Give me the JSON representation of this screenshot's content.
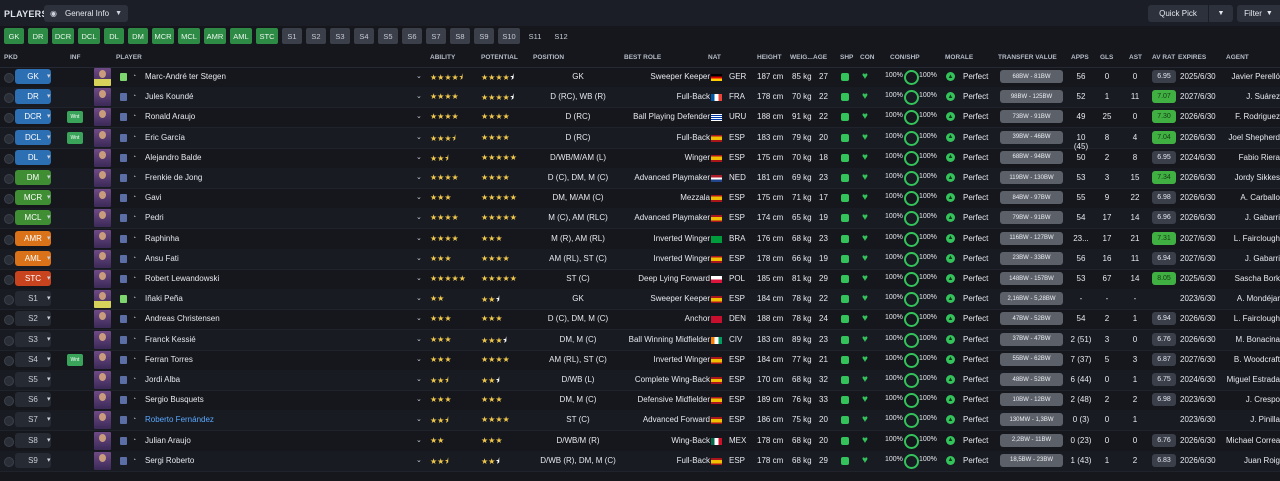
{
  "topbar": {
    "title": "PLAYERS",
    "view_label": "General Info",
    "quick_pick": "Quick Pick",
    "filter": "Filter"
  },
  "position_buttons": [
    "GK",
    "DR",
    "DCR",
    "DCL",
    "DL",
    "DM",
    "MCR",
    "MCL",
    "AMR",
    "AML",
    "STC",
    "S1",
    "S2",
    "S3",
    "S4",
    "S5",
    "S6",
    "S7",
    "S8",
    "S9",
    "S10",
    "S11",
    "S12"
  ],
  "columns": {
    "pkd": "PKD",
    "inf": "INF",
    "player": "PLAYER",
    "ability": "ABILITY",
    "potential": "POTENTIAL",
    "position": "POSITION",
    "best_role": "BEST ROLE",
    "nat": "NAT",
    "height": "HEIGHT",
    "weight": "WEIG...",
    "age": "AGE",
    "shp": "SHP",
    "con": "CON",
    "con_shp": "CON/SHP",
    "morale": "MORALE",
    "transfer_value": "TRANSFER VALUE",
    "apps": "APPS",
    "gls": "GLS",
    "ast": "AST",
    "av_rat": "AV RAT",
    "expires": "EXPIRES",
    "agent": "AGENT"
  },
  "players": [
    {
      "pos": "GK",
      "poscls": "gk",
      "inf": "",
      "name": "Marc-André ter Stegen",
      "ability": 4.5,
      "potential": 4.5,
      "position": "GK",
      "role": "Sweeper Keeper",
      "nat": "GER",
      "flag": "ger",
      "height": "187 cm",
      "weight": "85 kg",
      "age": "27",
      "con": "100%",
      "shp": "100%",
      "morale": "Perfect",
      "value": "68BW - 81BW",
      "apps": "56",
      "gls": "0",
      "ast": "0",
      "avr": "6.95",
      "avr_good": false,
      "expires": "2025/6/30",
      "agent": "Javier Perelló",
      "gk": true
    },
    {
      "pos": "DR",
      "poscls": "d",
      "inf": "",
      "name": "Jules Koundé",
      "ability": 4,
      "potential": 4.5,
      "position": "D (RC), WB (R)",
      "role": "Full-Back",
      "nat": "FRA",
      "flag": "fra",
      "height": "178 cm",
      "weight": "70 kg",
      "age": "22",
      "con": "100%",
      "shp": "100%",
      "morale": "Perfect",
      "value": "98BW - 125BW",
      "apps": "52",
      "gls": "1",
      "ast": "11",
      "avr": "7.07",
      "avr_good": true,
      "expires": "2027/6/30",
      "agent": "J. Suárez"
    },
    {
      "pos": "DCR",
      "poscls": "d",
      "inf": "Wnt",
      "name": "Ronald Araujo",
      "ability": 4,
      "potential": 4,
      "position": "D (RC)",
      "role": "Ball Playing Defender",
      "nat": "URU",
      "flag": "uru",
      "height": "188 cm",
      "weight": "91 kg",
      "age": "22",
      "con": "100%",
      "shp": "100%",
      "morale": "Perfect",
      "value": "73BW - 91BW",
      "apps": "49",
      "gls": "25",
      "ast": "0",
      "avr": "7.30",
      "avr_good": true,
      "expires": "2026/6/30",
      "agent": "F. Rodriguez"
    },
    {
      "pos": "DCL",
      "poscls": "d",
      "inf": "Wnt",
      "name": "Eric García",
      "ability": 3.5,
      "potential": 4,
      "position": "D (RC)",
      "role": "Full-Back",
      "nat": "ESP",
      "flag": "esp",
      "height": "183 cm",
      "weight": "79 kg",
      "age": "20",
      "con": "100%",
      "shp": "100%",
      "morale": "Perfect",
      "value": "39BW - 46BW",
      "apps": "10 (45)",
      "gls": "8",
      "ast": "4",
      "avr": "7.04",
      "avr_good": true,
      "expires": "2026/6/30",
      "agent": "Joel Shepherd"
    },
    {
      "pos": "DL",
      "poscls": "d",
      "inf": "",
      "name": "Alejandro Balde",
      "ability": 2.5,
      "potential": 5,
      "position": "D/WB/M/AM (L)",
      "role": "Winger",
      "nat": "ESP",
      "flag": "esp",
      "height": "175 cm",
      "weight": "70 kg",
      "age": "18",
      "con": "100%",
      "shp": "100%",
      "morale": "Perfect",
      "value": "68BW - 94BW",
      "apps": "50",
      "gls": "2",
      "ast": "8",
      "avr": "6.95",
      "avr_good": false,
      "expires": "2024/6/30",
      "agent": "Fabio Riera"
    },
    {
      "pos": "DM",
      "poscls": "m",
      "inf": "",
      "name": "Frenkie de Jong",
      "ability": 4,
      "potential": 4,
      "position": "D (C), DM, M (C)",
      "role": "Advanced Playmaker",
      "nat": "NED",
      "flag": "ned",
      "height": "181 cm",
      "weight": "69 kg",
      "age": "23",
      "con": "100%",
      "shp": "100%",
      "morale": "Perfect",
      "value": "119BW - 130BW",
      "apps": "53",
      "gls": "3",
      "ast": "15",
      "avr": "7.34",
      "avr_good": true,
      "expires": "2026/6/30",
      "agent": "Jordy Sikkes"
    },
    {
      "pos": "MCR",
      "poscls": "m",
      "inf": "",
      "name": "Gavi",
      "ability": 3,
      "potential": 5,
      "position": "DM, M/AM (C)",
      "role": "Mezzala",
      "nat": "ESP",
      "flag": "esp",
      "height": "175 cm",
      "weight": "71 kg",
      "age": "17",
      "con": "100%",
      "shp": "100%",
      "morale": "Perfect",
      "value": "84BW - 97BW",
      "apps": "55",
      "gls": "9",
      "ast": "22",
      "avr": "6.98",
      "avr_good": false,
      "expires": "2026/6/30",
      "agent": "A. Carballo"
    },
    {
      "pos": "MCL",
      "poscls": "m",
      "inf": "",
      "name": "Pedri",
      "ability": 4,
      "potential": 5,
      "position": "M (C), AM (RLC)",
      "role": "Advanced Playmaker",
      "nat": "ESP",
      "flag": "esp",
      "height": "174 cm",
      "weight": "65 kg",
      "age": "19",
      "con": "100%",
      "shp": "100%",
      "morale": "Perfect",
      "value": "79BW - 91BW",
      "apps": "54",
      "gls": "17",
      "ast": "14",
      "avr": "6.96",
      "avr_good": false,
      "expires": "2026/6/30",
      "agent": "J. Gabarri"
    },
    {
      "pos": "AMR",
      "poscls": "amc",
      "inf": "",
      "name": "Raphinha",
      "ability": 4,
      "potential": 3,
      "position": "M (R), AM (RL)",
      "role": "Inverted Winger",
      "nat": "BRA",
      "flag": "bra",
      "height": "176 cm",
      "weight": "68 kg",
      "age": "23",
      "con": "100%",
      "shp": "100%",
      "morale": "Perfect",
      "value": "116BW - 127BW",
      "apps": "23...",
      "gls": "17",
      "ast": "21",
      "avr": "7.31",
      "avr_good": true,
      "expires": "2027/6/30",
      "agent": "L. Fairclough"
    },
    {
      "pos": "AML",
      "poscls": "amc",
      "inf": "",
      "name": "Ansu Fati",
      "ability": 3,
      "potential": 4,
      "position": "AM (RL), ST (C)",
      "role": "Inverted Winger",
      "nat": "ESP",
      "flag": "esp",
      "height": "178 cm",
      "weight": "66 kg",
      "age": "19",
      "con": "100%",
      "shp": "100%",
      "morale": "Perfect",
      "value": "23BW - 33BW",
      "apps": "56",
      "gls": "16",
      "ast": "11",
      "avr": "6.94",
      "avr_good": false,
      "expires": "2027/6/30",
      "agent": "J. Gabarri"
    },
    {
      "pos": "STC",
      "poscls": "st",
      "inf": "",
      "name": "Robert Lewandowski",
      "ability": 5,
      "potential": 5,
      "position": "ST (C)",
      "role": "Deep Lying Forward",
      "nat": "POL",
      "flag": "pol",
      "height": "185 cm",
      "weight": "81 kg",
      "age": "29",
      "con": "100%",
      "shp": "100%",
      "morale": "Perfect",
      "value": "148BW - 157BW",
      "apps": "53",
      "gls": "67",
      "ast": "14",
      "avr": "8.05",
      "avr_good": true,
      "expires": "2025/6/30",
      "agent": "Sascha Bork"
    },
    {
      "pos": "S1",
      "poscls": "sub",
      "inf": "",
      "name": "Iñaki Peña",
      "ability": 2,
      "potential": 2.5,
      "position": "GK",
      "role": "Sweeper Keeper",
      "nat": "ESP",
      "flag": "esp",
      "height": "184 cm",
      "weight": "78 kg",
      "age": "22",
      "con": "100%",
      "shp": "100%",
      "morale": "Perfect",
      "value": "2,16BW - 5,28BW",
      "apps": "-",
      "gls": "-",
      "ast": "-",
      "avr": "",
      "avr_good": false,
      "expires": "2023/6/30",
      "agent": "A. Mondéjar",
      "gk": true
    },
    {
      "pos": "S2",
      "poscls": "sub",
      "inf": "",
      "name": "Andreas Christensen",
      "ability": 3,
      "potential": 3,
      "position": "D (C), DM, M (C)",
      "role": "Anchor",
      "nat": "DEN",
      "flag": "den",
      "height": "188 cm",
      "weight": "78 kg",
      "age": "24",
      "con": "100%",
      "shp": "100%",
      "morale": "Perfect",
      "value": "47BW - 52BW",
      "apps": "54",
      "gls": "2",
      "ast": "1",
      "avr": "6.94",
      "avr_good": false,
      "expires": "2026/6/30",
      "agent": "L. Fairclough"
    },
    {
      "pos": "S3",
      "poscls": "sub",
      "inf": "",
      "name": "Franck Kessié",
      "ability": 3,
      "potential": 3.5,
      "position": "DM, M (C)",
      "role": "Ball Winning Midfielder",
      "nat": "CIV",
      "flag": "civ",
      "height": "183 cm",
      "weight": "89 kg",
      "age": "23",
      "con": "100%",
      "shp": "100%",
      "morale": "Perfect",
      "value": "37BW - 47BW",
      "apps": "2 (51)",
      "gls": "3",
      "ast": "0",
      "avr": "6.76",
      "avr_good": false,
      "expires": "2026/6/30",
      "agent": "M. Bonacina"
    },
    {
      "pos": "S4",
      "poscls": "sub",
      "inf": "Wnt",
      "name": "Ferran Torres",
      "ability": 3,
      "potential": 4,
      "position": "AM (RL), ST (C)",
      "role": "Inverted Winger",
      "nat": "ESP",
      "flag": "esp",
      "height": "184 cm",
      "weight": "77 kg",
      "age": "21",
      "con": "100%",
      "shp": "100%",
      "morale": "Perfect",
      "value": "55BW - 62BW",
      "apps": "7 (37)",
      "gls": "5",
      "ast": "3",
      "avr": "6.87",
      "avr_good": false,
      "expires": "2027/6/30",
      "agent": "B. Woodcraft"
    },
    {
      "pos": "S5",
      "poscls": "sub",
      "inf": "",
      "name": "Jordi Alba",
      "ability": 2.5,
      "potential": 2.5,
      "position": "D/WB (L)",
      "role": "Complete Wing-Back",
      "nat": "ESP",
      "flag": "esp",
      "height": "170 cm",
      "weight": "68 kg",
      "age": "32",
      "con": "100%",
      "shp": "100%",
      "morale": "Perfect",
      "value": "48BW - 52BW",
      "apps": "6 (44)",
      "gls": "0",
      "ast": "1",
      "avr": "6.75",
      "avr_good": false,
      "expires": "2024/6/30",
      "agent": "Miguel Estrada"
    },
    {
      "pos": "S6",
      "poscls": "sub",
      "inf": "",
      "name": "Sergio Busquets",
      "ability": 3,
      "potential": 3,
      "position": "DM, M (C)",
      "role": "Defensive Midfielder",
      "nat": "ESP",
      "flag": "esp",
      "height": "189 cm",
      "weight": "76 kg",
      "age": "33",
      "con": "100%",
      "shp": "100%",
      "morale": "Perfect",
      "value": "10BW - 12BW",
      "apps": "2 (48)",
      "gls": "2",
      "ast": "2",
      "avr": "6.98",
      "avr_good": false,
      "expires": "2023/6/30",
      "agent": "J. Crespo"
    },
    {
      "pos": "S7",
      "poscls": "sub",
      "inf": "",
      "name": "Roberto Fernández",
      "blue": true,
      "ability": 2.5,
      "potential": 4,
      "position": "ST (C)",
      "role": "Advanced Forward",
      "nat": "ESP",
      "flag": "esp",
      "height": "186 cm",
      "weight": "75 kg",
      "age": "20",
      "con": "100%",
      "shp": "100%",
      "morale": "Perfect",
      "value": "130MW - 1,3BW",
      "apps": "0 (3)",
      "gls": "0",
      "ast": "1",
      "avr": "",
      "avr_good": false,
      "expires": "2023/6/30",
      "agent": "J. Pinilla"
    },
    {
      "pos": "S8",
      "poscls": "sub",
      "inf": "",
      "name": "Julian Araujo",
      "ability": 2,
      "potential": 3,
      "position": "D/WB/M (R)",
      "role": "Wing-Back",
      "nat": "MEX",
      "flag": "mex",
      "height": "178 cm",
      "weight": "68 kg",
      "age": "20",
      "con": "100%",
      "shp": "100%",
      "morale": "Perfect",
      "value": "2,2BW - 11BW",
      "apps": "0 (23)",
      "gls": "0",
      "ast": "0",
      "avr": "6.76",
      "avr_good": false,
      "expires": "2026/6/30",
      "agent": "Michael Correa"
    },
    {
      "pos": "S9",
      "poscls": "sub",
      "inf": "",
      "name": "Sergi Roberto",
      "ability": 2.5,
      "potential": 2.5,
      "position": "D/WB (R), DM, M (C)",
      "role": "Full-Back",
      "nat": "ESP",
      "flag": "esp",
      "height": "178 cm",
      "weight": "68 kg",
      "age": "29",
      "con": "100%",
      "shp": "100%",
      "morale": "Perfect",
      "value": "18,5BW - 23BW",
      "apps": "1 (43)",
      "gls": "1",
      "ast": "2",
      "avr": "6.83",
      "avr_good": false,
      "expires": "2026/6/30",
      "agent": "Juan Roig"
    }
  ]
}
